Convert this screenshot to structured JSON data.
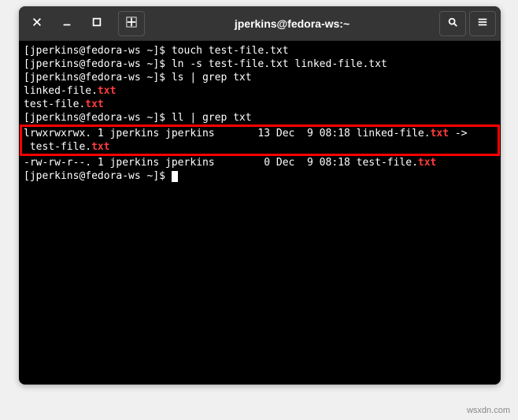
{
  "window": {
    "title": "jperkins@fedora-ws:~"
  },
  "icons": {
    "close": "close-icon",
    "minimize": "minimize-icon",
    "maximize": "maximize-icon",
    "newtab": "newtab-icon",
    "search": "search-icon",
    "menu": "menu-icon"
  },
  "terminal": {
    "prompt": "[jperkins@fedora-ws ~]$ ",
    "lines": [
      {
        "prompt": true,
        "cmd": "touch test-file.txt"
      },
      {
        "prompt": true,
        "cmd": "ln -s test-file.txt linked-file.txt"
      },
      {
        "prompt": true,
        "cmd": "ls | grep txt"
      }
    ],
    "grep_out": [
      {
        "pre": "linked-file.",
        "match": "txt"
      },
      {
        "pre": "test-file.",
        "match": "txt"
      }
    ],
    "cmd_ll": "ll | grep txt",
    "ll_highlight": {
      "seg1": "lrwxrwxrwx. 1 jperkins jperkins       13 Dec  9 08:18 linked-file.",
      "seg2": "txt",
      "seg3": " ->",
      "seg4": " test-file.",
      "seg5": "txt"
    },
    "ll_line2": {
      "seg1": "-rw-rw-r--. 1 jperkins jperkins        0 Dec  9 08:18 test-file.",
      "seg2": "txt"
    }
  },
  "watermark": "wsxdn.com"
}
